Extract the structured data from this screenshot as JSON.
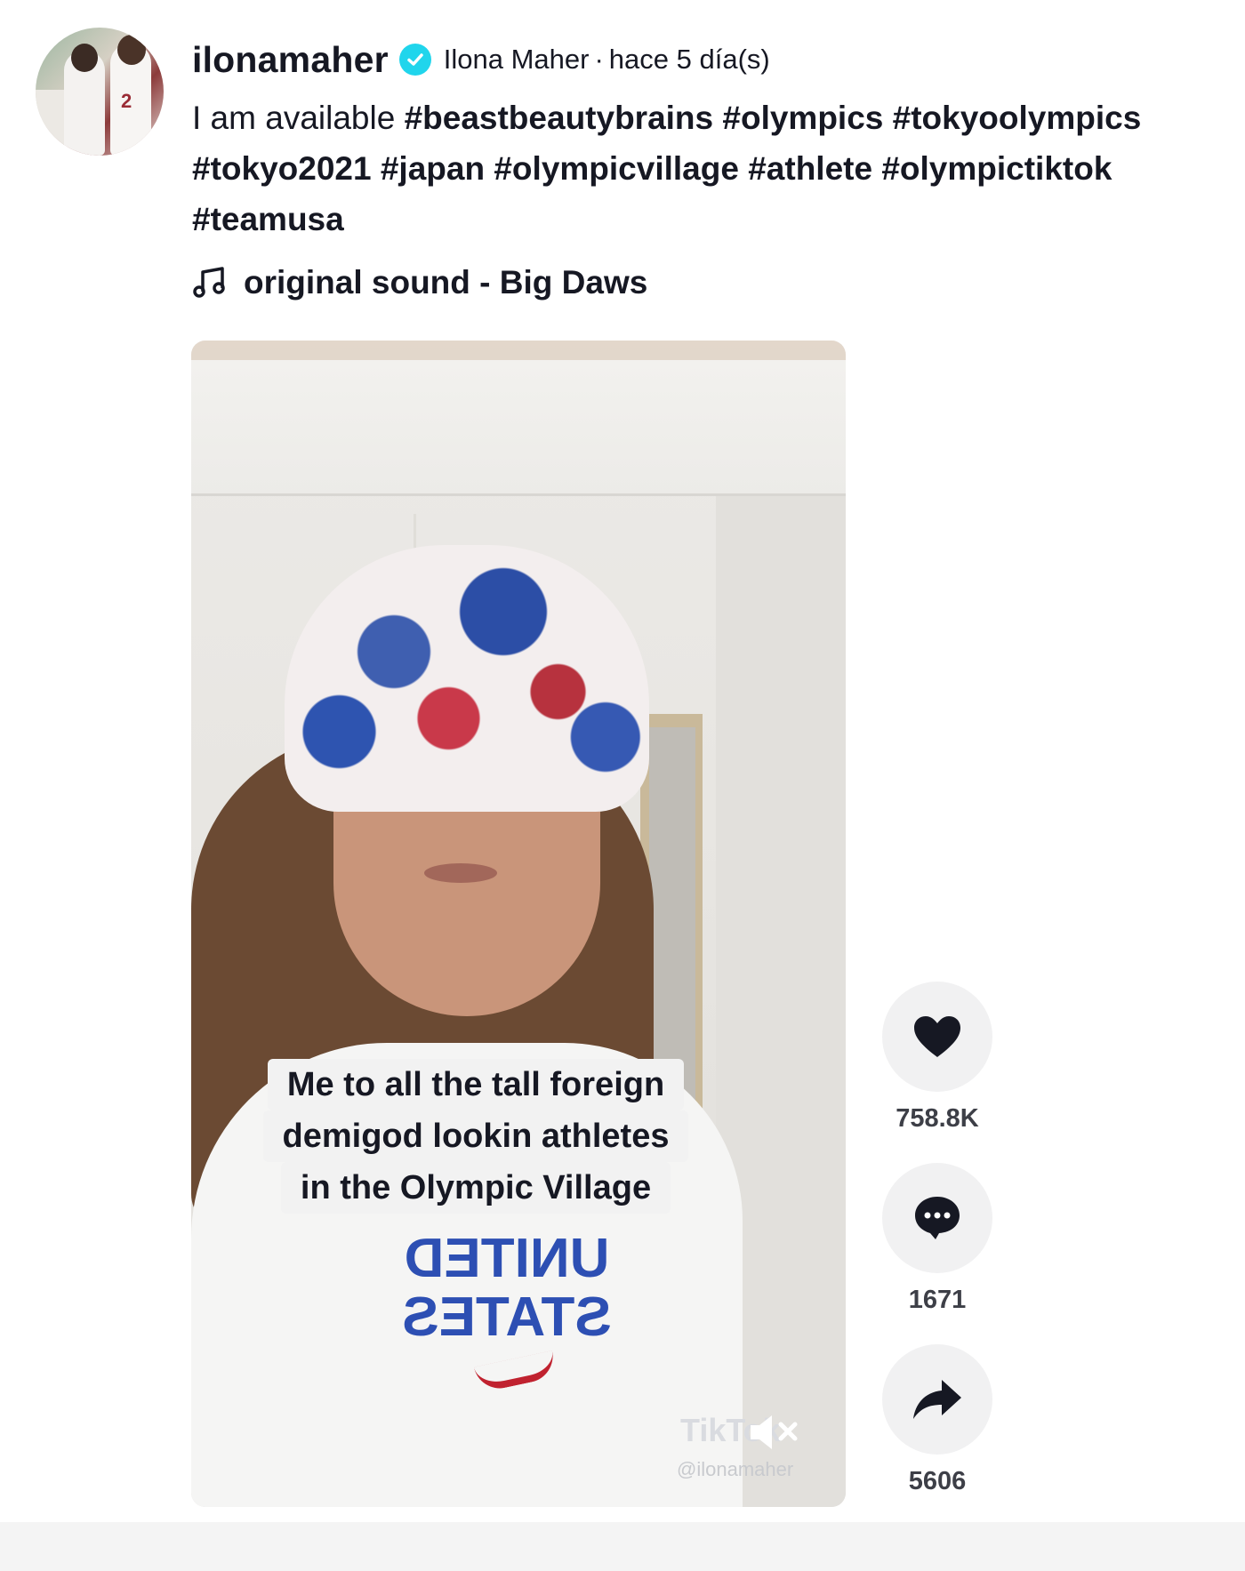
{
  "author": {
    "username": "ilonamaher",
    "verified": true,
    "nickname": "Ilona Maher",
    "separator": "·",
    "posted": "hace 5 día(s)"
  },
  "caption": {
    "text": "I am available",
    "hashtags": [
      "#beastbeautybrains",
      "#olympics",
      "#tokyoolympics",
      "#tokyo2021",
      "#japan",
      "#olympicvillage",
      "#athlete",
      "#olympictiktok",
      "#teamusa"
    ]
  },
  "music": {
    "icon": "music-note-icon",
    "label": "original sound - Big Daws"
  },
  "video": {
    "overlay_lines": [
      "Me to all the tall foreign",
      "demigod lookin athletes",
      "in the Olympic Village"
    ],
    "shirt_text": [
      "UNITED",
      "STATES"
    ],
    "watermark_logo": "TikTok",
    "watermark_user": "@ilonamaher",
    "muted": true
  },
  "actions": {
    "likes": "758.8K",
    "comments": "1671",
    "shares": "5606"
  },
  "colors": {
    "verified": "#20d5ec",
    "text": "#161823",
    "action_bg": "#f1f1f2"
  }
}
